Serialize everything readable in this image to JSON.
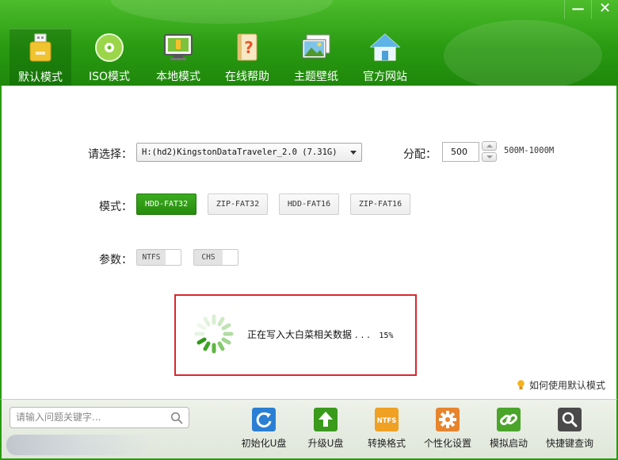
{
  "window": {
    "minimize_glyph": "—",
    "close_glyph": "✕"
  },
  "nav": [
    {
      "label": "默认模式",
      "icon": "usb-drive-icon",
      "active": true
    },
    {
      "label": "ISO模式",
      "icon": "disc-icon"
    },
    {
      "label": "本地模式",
      "icon": "monitor-icon"
    },
    {
      "label": "在线帮助",
      "icon": "help-book-icon"
    },
    {
      "label": "主题壁纸",
      "icon": "wallpaper-icon"
    },
    {
      "label": "官方网站",
      "icon": "home-icon"
    }
  ],
  "form": {
    "select_label": "请选择：",
    "device_value": "H:(hd2)KingstonDataTraveler_2.0 (7.31G)",
    "alloc_label": "分配：",
    "alloc_value": "500",
    "alloc_range": "500M-1000M",
    "mode_label": "模式：",
    "modes": [
      "HDD-FAT32",
      "ZIP-FAT32",
      "HDD-FAT16",
      "ZIP-FAT16"
    ],
    "active_mode": "HDD-FAT32",
    "params_label": "参数：",
    "params": [
      "NTFS",
      "CHS"
    ]
  },
  "progress": {
    "message": "正在写入大白菜相关数据 . . .",
    "percent_text": "15%",
    "percent": 15
  },
  "help_link": "如何使用默认模式",
  "search": {
    "placeholder": "请输入问题关键字..."
  },
  "toolbar": [
    {
      "label": "初始化U盘",
      "icon": "refresh-icon",
      "color": "#2a7fd4"
    },
    {
      "label": "升级U盘",
      "icon": "upgrade-arrow-icon",
      "color": "#3a9a1c"
    },
    {
      "label": "转换格式",
      "icon": "ntfs-icon",
      "color": "#f0a022",
      "icon_text": "NTFS"
    },
    {
      "label": "个性化设置",
      "icon": "gear-icon",
      "color": "#e8842c"
    },
    {
      "label": "模拟启动",
      "icon": "link-icon",
      "color": "#4aa52a"
    },
    {
      "label": "快捷键查询",
      "icon": "search-key-icon",
      "color": "#4a4a4a"
    }
  ],
  "colors": {
    "brand_green": "#2a9a12",
    "highlight_red": "#d9272e"
  }
}
